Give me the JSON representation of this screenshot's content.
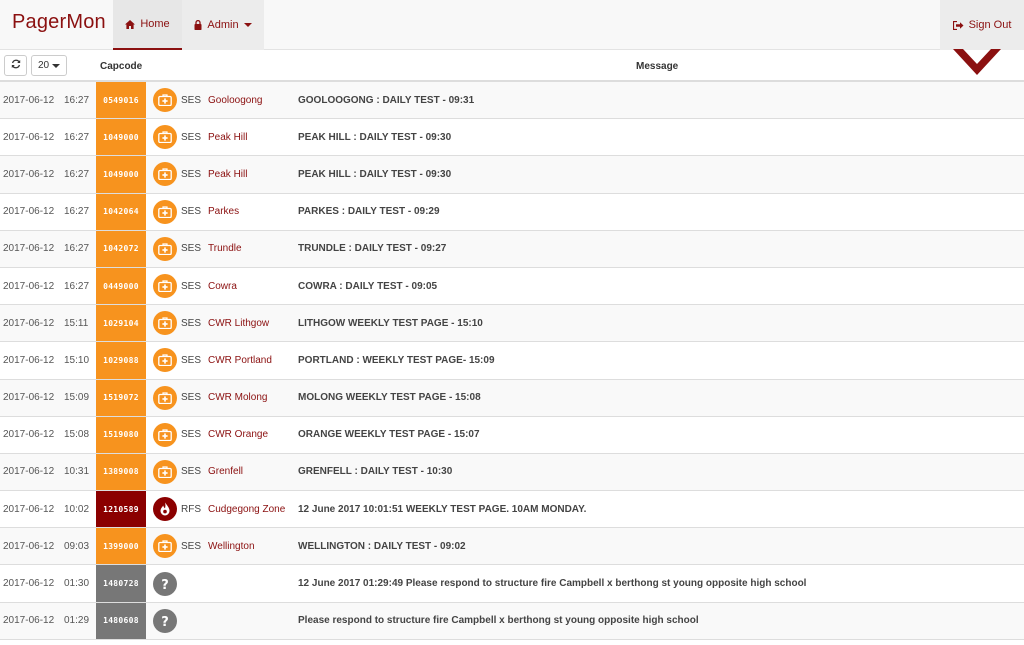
{
  "navbar": {
    "brand": "PagerMon",
    "home_label": "Home",
    "admin_label": "Admin",
    "signout_label": "Sign Out"
  },
  "table": {
    "per_page": "20",
    "col_capcode": "Capcode",
    "col_message": "Message",
    "rows": [
      {
        "date": "2017-06-12",
        "time": "16:27",
        "capcode": "0549016",
        "agency": "SES",
        "alias": "Gooloogong",
        "message": "GOOLOOGONG : DAILY TEST - 09:31",
        "kind": "ses"
      },
      {
        "date": "2017-06-12",
        "time": "16:27",
        "capcode": "1049000",
        "agency": "SES",
        "alias": "Peak Hill",
        "message": "PEAK HILL : DAILY TEST - 09:30",
        "kind": "ses"
      },
      {
        "date": "2017-06-12",
        "time": "16:27",
        "capcode": "1049000",
        "agency": "SES",
        "alias": "Peak Hill",
        "message": "PEAK HILL : DAILY TEST - 09:30",
        "kind": "ses"
      },
      {
        "date": "2017-06-12",
        "time": "16:27",
        "capcode": "1042064",
        "agency": "SES",
        "alias": "Parkes",
        "message": "PARKES : DAILY TEST - 09:29",
        "kind": "ses"
      },
      {
        "date": "2017-06-12",
        "time": "16:27",
        "capcode": "1042072",
        "agency": "SES",
        "alias": "Trundle",
        "message": "TRUNDLE : DAILY TEST - 09:27",
        "kind": "ses"
      },
      {
        "date": "2017-06-12",
        "time": "16:27",
        "capcode": "0449000",
        "agency": "SES",
        "alias": "Cowra",
        "message": "COWRA : DAILY TEST - 09:05",
        "kind": "ses"
      },
      {
        "date": "2017-06-12",
        "time": "15:11",
        "capcode": "1029104",
        "agency": "SES",
        "alias": "CWR Lithgow",
        "message": "LITHGOW WEEKLY TEST PAGE - 15:10",
        "kind": "ses"
      },
      {
        "date": "2017-06-12",
        "time": "15:10",
        "capcode": "1029088",
        "agency": "SES",
        "alias": "CWR Portland",
        "message": "PORTLAND : WEEKLY TEST PAGE- 15:09",
        "kind": "ses"
      },
      {
        "date": "2017-06-12",
        "time": "15:09",
        "capcode": "1519072",
        "agency": "SES",
        "alias": "CWR Molong",
        "message": "MOLONG WEEKLY TEST PAGE - 15:08",
        "kind": "ses"
      },
      {
        "date": "2017-06-12",
        "time": "15:08",
        "capcode": "1519080",
        "agency": "SES",
        "alias": "CWR Orange",
        "message": "ORANGE WEEKLY TEST PAGE - 15:07",
        "kind": "ses"
      },
      {
        "date": "2017-06-12",
        "time": "10:31",
        "capcode": "1389008",
        "agency": "SES",
        "alias": "Grenfell",
        "message": "GRENFELL : DAILY TEST - 10:30",
        "kind": "ses"
      },
      {
        "date": "2017-06-12",
        "time": "10:02",
        "capcode": "1210589",
        "agency": "RFS",
        "alias": "Cudgegong Zone",
        "message": "12 June 2017 10:01:51 WEEKLY TEST PAGE. 10AM MONDAY.",
        "kind": "rfs"
      },
      {
        "date": "2017-06-12",
        "time": "09:03",
        "capcode": "1399000",
        "agency": "SES",
        "alias": "Wellington",
        "message": "WELLINGTON : DAILY TEST - 09:02",
        "kind": "ses"
      },
      {
        "date": "2017-06-12",
        "time": "01:30",
        "capcode": "1480728",
        "agency": "",
        "alias": "",
        "message": "12 June 2017 01:29:49 Please respond to structure fire Campbell x berthong st young opposite high school",
        "kind": "unknown"
      },
      {
        "date": "2017-06-12",
        "time": "01:29",
        "capcode": "1480608",
        "agency": "",
        "alias": "",
        "message": "Please respond to structure fire Campbell x berthong st young opposite high school",
        "kind": "unknown"
      }
    ]
  },
  "colors": {
    "brand": "#8b1010",
    "ses": "#f7931e",
    "rfs": "#8b0000",
    "unknown": "#777777"
  },
  "icons": {
    "home": "home-icon",
    "admin": "lock-icon",
    "signout": "sign-out-icon",
    "refresh": "refresh-icon",
    "ses": "ses-medkit-icon",
    "rfs": "rfs-flame-icon",
    "unknown": "question-icon",
    "collapse": "chevron-down-icon"
  }
}
